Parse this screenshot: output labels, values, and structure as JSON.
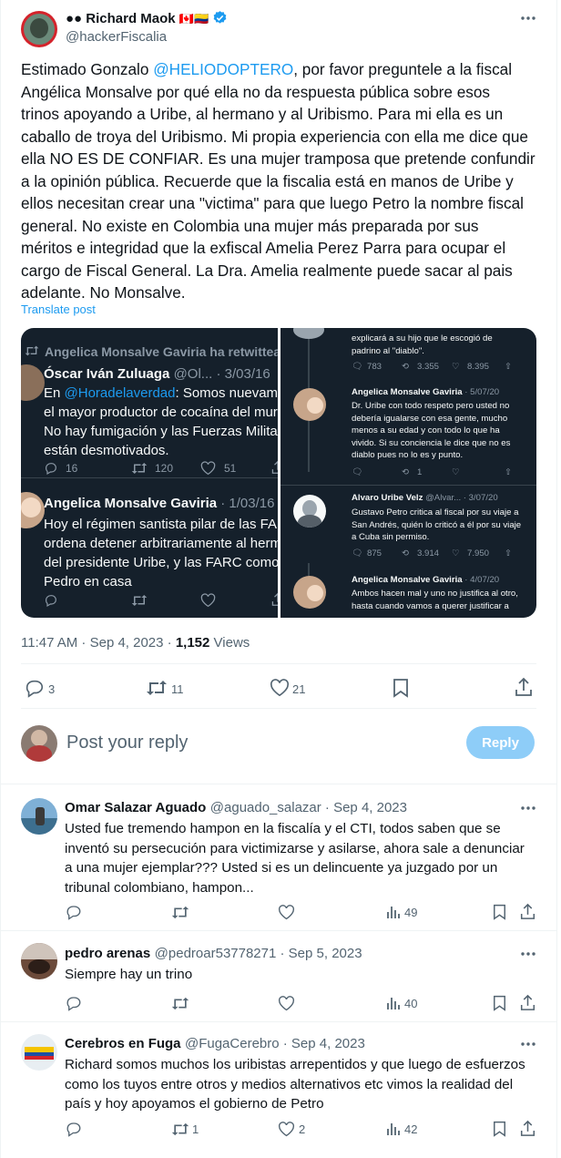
{
  "tweet": {
    "author_name": "●● Richard Maok",
    "author_flags": "🇨🇦🇨🇴",
    "author_handle": "@hackerFiscalia",
    "text_before_mention": "Estimado Gonzalo ",
    "mention": "@HELIODOPTERO",
    "text_lines": [
      "Estimado Gonzalo @HELIODOPTERO, por favor preguntele a la fiscal",
      "Angélica Monsalve por qué ella no da respuesta pública sobre esos",
      "trinos apoyando a Uribe, al hermano y al Uribismo. Para mi ella es un",
      "caballo de troya del Uribismo. Mi propia experiencia con ella me dice que",
      "ella NO ES DE CONFIAR. Es una mujer tramposa que pretende confundir",
      "a la opinión pública. Recuerde que la fiscalia está en manos de Uribe y",
      "ellos necesitan crear una \"victima\" para que luego Petro la nombre fiscal",
      "general. No existe en Colombia una mujer más preparada por sus",
      "méritos e integridad que la exfiscal Amelia Perez Parra para ocupar el",
      "cargo de Fiscal General. La Dra. Amelia realmente puede sacar al pais",
      "adelante. No Monsalve."
    ],
    "line1_rest": ", por favor preguntele a la fiscal",
    "translate": "Translate post",
    "time": "11:47 AM · Sep 4, 2023 · ",
    "views_count": "1,152",
    "views_label": " Views",
    "replies": "3",
    "retweets": "11",
    "likes": "21"
  },
  "screenshot": {
    "left": {
      "retweet_note": "Angelica Monsalve Gaviria ha retwitteado",
      "t1_name": "Óscar Iván Zuluaga",
      "t1_meta": "@Ol... · 3/03/16",
      "t1_mention": "@Horadelaverdad",
      "t1_lines": [
        "En @Horadelaverdad: Somos nuevame",
        "el mayor productor de cocaína del mur",
        "No hay fumigación y las Fuerzas Milita",
        "están desmotivados."
      ],
      "t1_reply": "16",
      "t1_rt": "120",
      "t1_like": "51",
      "t2_name": "Angelica Monsalve Gaviria",
      "t2_meta": "· 1/03/16",
      "t2_lines": [
        "Hoy el régimen santista pilar de las FAI",
        "ordena detener arbitrariamente al herm",
        "del presidente Uribe, y las FARC como",
        "Pedro en casa"
      ]
    },
    "right": {
      "top_lines": [
        "explicará a su hijo que le escogió de",
        "padrino al \"diablo\"."
      ],
      "top_reply": "783",
      "top_rt": "3.355",
      "top_like": "8.395",
      "r1_name": "Angelica Monsalve Gaviria",
      "r1_meta": "· 5/07/20",
      "r1_lines": [
        "Dr. Uribe con todo respeto pero usted no",
        "debería igualarse con esa gente, mucho",
        "menos a su edad y con todo lo que ha",
        "vivido. Si su conciencia le dice que no es",
        "diablo pues no lo es y punto."
      ],
      "r1_rt": "1",
      "r2_name": "Alvaro Uribe Velz",
      "r2_meta": "@Alvar... · 3/07/20",
      "r2_lines": [
        "Gustavo Petro critica al fiscal por su viaje a",
        "San Andrés, quién lo criticó a él por su viaje",
        "a Cuba sin permiso."
      ],
      "r2_reply": "875",
      "r2_rt": "3.914",
      "r2_like": "7.950",
      "r3_name": "Angelica Monsalve Gaviria",
      "r3_meta": "· 4/07/20",
      "r3_lines": [
        "Ambos hacen mal y uno no justifica al otro,",
        "hasta cuando vamos a querer justificar a"
      ]
    }
  },
  "compose": {
    "placeholder": "Post your reply",
    "button": "Reply"
  },
  "replies": [
    {
      "name": "Omar Salazar Aguado",
      "handle": "@aguado_salazar · Sep 4, 2023",
      "lines": [
        "Usted fue tremendo hampon en la fiscalía y el CTI, todos saben que se",
        "inventó su persecución para victimizarse y asilarse, ahora sale a denunciar",
        "a una mujer ejemplar??? Usted si es un delincuente ya juzgado por un",
        "tribunal colombiano, hampon..."
      ],
      "views": "49"
    },
    {
      "name": "pedro arenas",
      "handle": "@pedroar53778271 · Sep 5, 2023",
      "lines": [
        "Siempre hay un trino"
      ],
      "views": "40"
    },
    {
      "name": "Cerebros en Fuga",
      "handle": "@FugaCerebro · Sep 4, 2023",
      "lines": [
        "Richard somos muchos los uribistas arrepentidos y que luego de esfuerzos",
        "como los tuyos entre otros y medios alternativos etc vimos la realidad del",
        "país y hoy apoyamos el gobierno de Petro"
      ],
      "retweets": "1",
      "likes": "2",
      "views": "42"
    }
  ],
  "colors": {
    "accent": "#1d9bf0",
    "muted": "#536471",
    "dark_bg": "#15202b",
    "reply_btn": "#8ecdf8"
  }
}
